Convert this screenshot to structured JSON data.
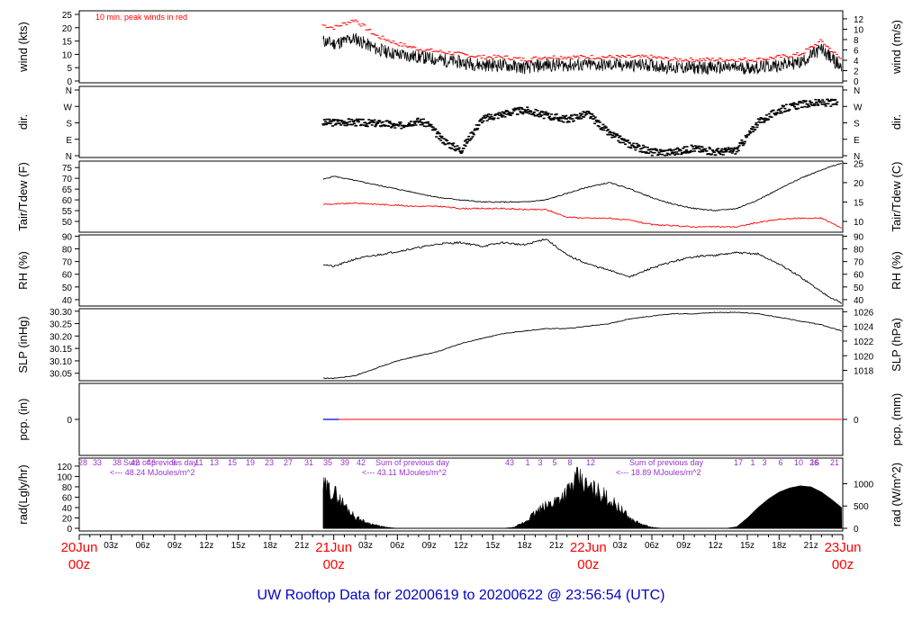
{
  "title": "UW Rooftop Data for 20200619  to  20200622 @ 23:56:54  (UTC)",
  "colors": {
    "peak": "#ff0000",
    "dew": "#ff0000",
    "title": "#0000cc",
    "day_label": "#ff0000",
    "solar_note": "#9933cc",
    "pcp_blue": "#0000cc",
    "trace": "#000000"
  },
  "time_axis": {
    "tick_labels": [
      "03z",
      "06z",
      "09z",
      "12z",
      "15z",
      "18z",
      "21z",
      "03z",
      "06z",
      "09z",
      "12z",
      "15z",
      "18z",
      "21z",
      "03z",
      "06z",
      "09z",
      "12z",
      "15z",
      "18z",
      "21z"
    ],
    "day_labels": [
      {
        "line1": "20Jun",
        "line2": "00z"
      },
      {
        "line1": "21Jun",
        "line2": "00z"
      },
      {
        "line1": "22Jun",
        "line2": "00z"
      },
      {
        "line1": "23Jun",
        "line2": "00z"
      }
    ]
  },
  "chart_data": [
    {
      "type": "line",
      "panel": "wind",
      "ylabel": "wind (kts)",
      "ylabel_right": "wind (m/s)",
      "annotation": "10 min. peak winds in red",
      "ylim": [
        0,
        25
      ],
      "yticks": [
        "0",
        "5",
        "10",
        "15",
        "20",
        "25"
      ],
      "yticks_right": [
        "0",
        "2",
        "4",
        "6",
        "8",
        "10",
        "12"
      ],
      "x_unit": "hours since 20Jun 00z",
      "x": [
        23,
        24,
        26,
        28,
        30,
        32,
        34,
        36,
        38,
        40,
        42,
        44,
        46,
        48,
        50,
        52,
        54,
        56,
        58,
        60,
        62,
        64,
        66,
        68,
        70,
        71.9
      ],
      "series": [
        {
          "role": "mean wind",
          "values": [
            15,
            14,
            16,
            12,
            10,
            9,
            8,
            7,
            6,
            6,
            5,
            6,
            6,
            6,
            6,
            6,
            6,
            5,
            5,
            5,
            5,
            5,
            6,
            7,
            12,
            5
          ]
        },
        {
          "role": "peak wind",
          "values": [
            21,
            20,
            23,
            17,
            14,
            12,
            11,
            10,
            9,
            9,
            8,
            9,
            9,
            9,
            9,
            9,
            9,
            8,
            8,
            8,
            8,
            8,
            9,
            10,
            15,
            8
          ]
        }
      ]
    },
    {
      "type": "scatter",
      "panel": "dir",
      "ylabel": "dir.",
      "ylabel_right": "dir.",
      "ylim": [
        0,
        360
      ],
      "yticks": [
        "N",
        "E",
        "S",
        "W",
        "N"
      ],
      "x_unit": "hours since 20Jun 00z",
      "x": [
        23,
        25,
        27,
        29,
        30,
        31,
        32,
        33,
        34,
        35,
        36,
        38,
        40,
        42,
        44,
        46,
        48,
        50,
        52,
        54,
        56,
        58,
        60,
        62,
        64,
        66,
        68,
        70,
        71.5
      ],
      "values": [
        180,
        185,
        180,
        175,
        160,
        180,
        190,
        170,
        100,
        60,
        30,
        200,
        230,
        250,
        220,
        200,
        230,
        120,
        60,
        20,
        20,
        40,
        20,
        30,
        180,
        250,
        280,
        290,
        290
      ]
    },
    {
      "type": "line",
      "panel": "temp",
      "ylabel": "Tair/Tdew (F)",
      "ylabel_right": "Tair/Tdew (C)",
      "ylim": [
        45,
        78
      ],
      "yticks": [
        "50",
        "55",
        "60",
        "65",
        "70",
        "75"
      ],
      "yticks_right": [
        "10",
        "15",
        "20",
        "25"
      ],
      "x_unit": "hours since 20Jun 00z",
      "x": [
        23,
        24,
        26,
        28,
        30,
        32,
        34,
        36,
        38,
        40,
        42,
        44,
        46,
        48,
        50,
        52,
        54,
        56,
        58,
        60,
        62,
        64,
        66,
        68,
        70,
        71.9
      ],
      "series": [
        {
          "role": "air temperature",
          "values": [
            69.5,
            71,
            69,
            67,
            65,
            63,
            61,
            60,
            59,
            59,
            59,
            60,
            63,
            66,
            68,
            65,
            61,
            58,
            56,
            55,
            56,
            60,
            65,
            70,
            74,
            77
          ]
        },
        {
          "role": "dew point",
          "values": [
            58,
            58,
            58.5,
            58,
            57.5,
            57,
            57,
            56,
            56,
            56,
            55.5,
            55.5,
            52,
            51.5,
            51.5,
            50.5,
            48.5,
            48,
            47.5,
            47.5,
            47.5,
            49.5,
            51,
            51.5,
            51.5,
            47
          ]
        }
      ]
    },
    {
      "type": "line",
      "panel": "rh",
      "ylabel": "RH (%)",
      "ylabel_right": "RH (%)",
      "ylim": [
        35,
        91
      ],
      "yticks": [
        "40",
        "50",
        "60",
        "70",
        "80",
        "90"
      ],
      "yticks_right": [
        "40",
        "50",
        "60",
        "70",
        "80",
        "90"
      ],
      "x_unit": "hours since 20Jun 00z",
      "x": [
        23,
        24,
        26,
        28,
        30,
        32,
        34,
        36,
        38,
        40,
        42,
        44,
        46,
        48,
        50,
        52,
        54,
        56,
        58,
        60,
        62,
        64,
        66,
        68,
        70,
        71.9
      ],
      "values": [
        68,
        66,
        72,
        75,
        78,
        81,
        84,
        85,
        82,
        85,
        83,
        88,
        75,
        68,
        63,
        58,
        65,
        70,
        74,
        75,
        77,
        76,
        68,
        58,
        46,
        37
      ]
    },
    {
      "type": "line",
      "panel": "slp",
      "ylabel": "SLP (inHg)",
      "ylabel_right": "SLP (hPa)",
      "ylim": [
        30.02,
        30.31
      ],
      "yticks": [
        "30.05",
        "30.10",
        "30.15",
        "30.20",
        "30.25",
        "30.30"
      ],
      "yticks_right": [
        "1018",
        "1020",
        "1022",
        "1024",
        "1026"
      ],
      "x_unit": "hours since 20Jun 00z",
      "x": [
        23,
        24,
        26,
        28,
        30,
        32,
        34,
        36,
        38,
        40,
        42,
        44,
        46,
        48,
        50,
        52,
        54,
        56,
        58,
        60,
        62,
        64,
        66,
        68,
        70,
        71.9
      ],
      "values": [
        30.03,
        30.03,
        30.04,
        30.07,
        30.1,
        30.12,
        30.14,
        30.17,
        30.19,
        30.21,
        30.22,
        30.23,
        30.23,
        30.24,
        30.25,
        30.27,
        30.28,
        30.29,
        30.29,
        30.295,
        30.295,
        30.29,
        30.275,
        30.26,
        30.245,
        30.22
      ]
    },
    {
      "type": "line",
      "panel": "pcp",
      "ylabel": "pcp. (in)",
      "ylabel_right": "pcp. (mm)",
      "yticks": [
        "0"
      ],
      "yticks_right": [
        "0"
      ],
      "x_unit": "hours since 20Jun 00z",
      "x": [
        23,
        71.9
      ],
      "values": [
        0,
        0
      ]
    },
    {
      "type": "area",
      "panel": "rad",
      "ylabel": "rad(Lgly/hr)",
      "ylabel_right": "rad (W/m^2)",
      "ylim": [
        0,
        125
      ],
      "yticks": [
        "0",
        "20",
        "40",
        "60",
        "80",
        "100",
        "120"
      ],
      "yticks_right": [
        "0",
        "500",
        "1000"
      ],
      "x_unit": "hours since 20Jun 00z",
      "x": [
        23,
        23.5,
        24,
        25,
        26,
        27,
        28,
        29,
        30,
        31,
        32,
        33,
        34,
        35,
        36,
        37,
        38,
        39,
        40,
        41,
        42,
        43,
        44,
        45,
        46,
        47,
        48,
        49,
        50,
        51,
        52,
        53,
        54,
        55,
        56,
        57,
        58,
        59,
        60,
        61,
        62,
        63,
        64,
        65,
        66,
        67,
        68,
        69,
        70,
        71,
        71.9
      ],
      "values": [
        80,
        75,
        70,
        45,
        22,
        12,
        6,
        2,
        0,
        0,
        0,
        0,
        0,
        0,
        0,
        0,
        0,
        0,
        0,
        2,
        12,
        30,
        42,
        55,
        70,
        95,
        78,
        70,
        55,
        38,
        18,
        8,
        2,
        0,
        0,
        0,
        0,
        0,
        0,
        0,
        3,
        20,
        40,
        57,
        70,
        78,
        82,
        80,
        70,
        55,
        40
      ],
      "labels": [
        "28",
        "33",
        "38",
        "42",
        "46",
        "9",
        "11",
        "13",
        "15",
        "19",
        "23",
        "27",
        "31",
        "35",
        "39",
        "42",
        "43",
        "1",
        "3",
        "5",
        "8",
        "12",
        "17",
        "1",
        "3",
        "6",
        "10",
        "16",
        "21",
        "26"
      ],
      "notes": [
        {
          "text": "Sum of previous day",
          "line2": "<--- 48.24 MJoules/m^2"
        },
        {
          "text": "Sum of previous day",
          "line2": "<--- 43.11 MJoules/m^2"
        },
        {
          "text": "Sum of previous day",
          "line2": "<--- 18.89 MJoules/m^2"
        }
      ]
    }
  ]
}
